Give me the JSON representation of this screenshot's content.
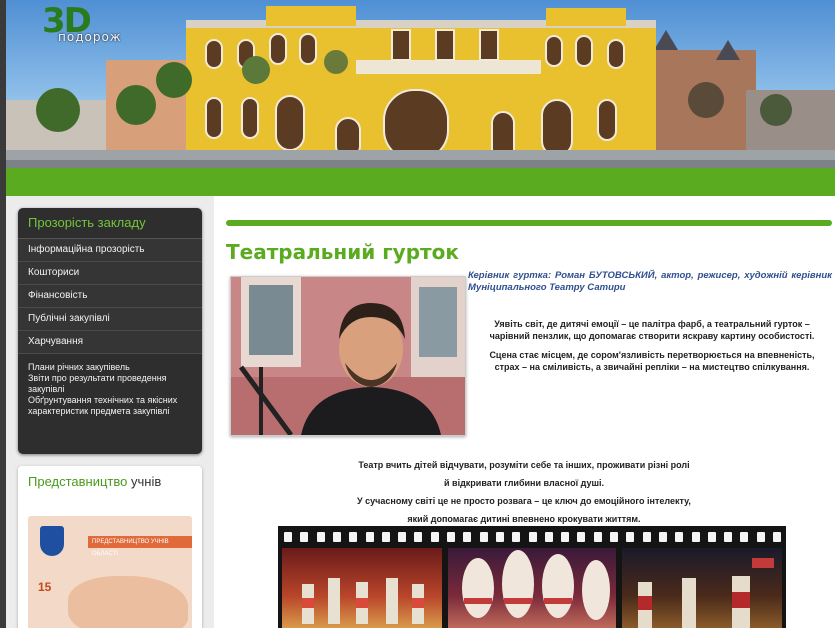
{
  "header": {
    "logo_mark": "3D",
    "logo_text": "подорож"
  },
  "sidebar": {
    "menu_title": "Прозорість закладу",
    "items": [
      {
        "label": "Інформаційна прозорість"
      },
      {
        "label": "Кошториси"
      },
      {
        "label": "Фінансовість"
      },
      {
        "label": "Публічні закупівлі"
      },
      {
        "label": "Харчування"
      }
    ],
    "sub_items": [
      "Плани річних закупівель",
      "Звіти про результати проведення закупівлі",
      "Обґрунтування технічних та якісних характеристик предмета закупівлі"
    ],
    "rep_title_green": "Представництво",
    "rep_title_dark": "учнів",
    "rep_badge": "ПРЕДСТАВНИЦТВО УЧНІВ ОБЛАСТІ",
    "rep_number": "15"
  },
  "main": {
    "title": "Театральний гурток",
    "leader": "Керівник гуртка: Роман БУТОВСЬКИЙ, актор, режисер, художній керівник Муніципального Театру Сатири",
    "intro_1": "Уявіть світ, де дитячі емоції – це палітра фарб, а театральний гурток – чарівний пензлик, що допомагає створити яскраву картину особистості.",
    "intro_2": "Сцена стає місцем, де сором'язливість перетворюється на впевненість, страх – на сміливість, а звичайні репліки – на мистецтво спілкування.",
    "body_1": "Театр вчить дітей відчувати, розуміти себе та інших, проживати різні ролі",
    "body_2": "й відкривати глибини власної душі.",
    "body_3": "У сучасному світі це не просто розвага – це ключ до емоційного інтелекту,",
    "body_4": "який допомагає дитині впевнено крокувати життям."
  },
  "colors": {
    "accent_green": "#5aab1f",
    "menu_bg": "#2e2e2e",
    "leader_blue": "#2f4f8f"
  }
}
